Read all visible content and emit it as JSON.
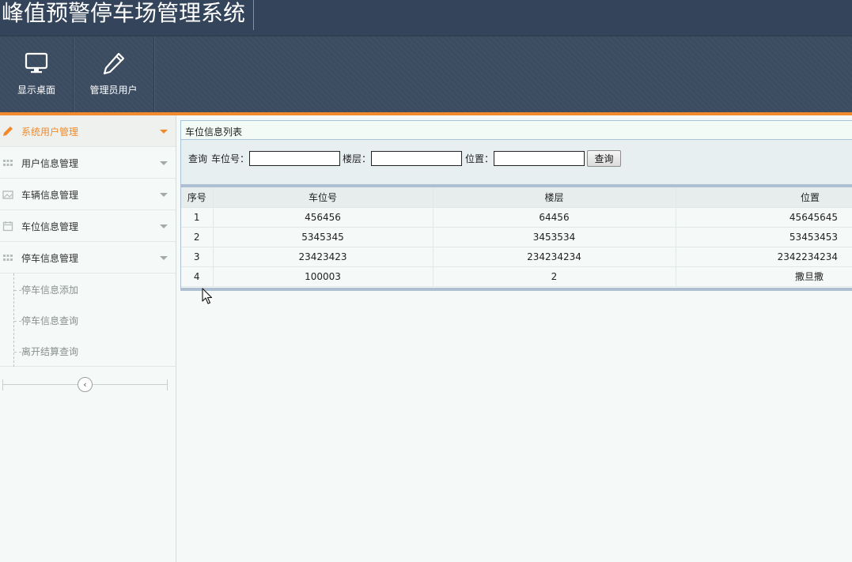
{
  "app": {
    "title": "峰值预警停车场管理系统"
  },
  "toolbar": {
    "items": [
      {
        "label": "显示桌面",
        "icon": "monitor-icon"
      },
      {
        "label": "管理员用户",
        "icon": "pencil-icon"
      }
    ]
  },
  "sidebar": {
    "menu": [
      {
        "label": "系统用户管理",
        "icon": "pencil-icon",
        "active": true
      },
      {
        "label": "用户信息管理",
        "icon": "grid-icon"
      },
      {
        "label": "车辆信息管理",
        "icon": "image-icon"
      },
      {
        "label": "车位信息管理",
        "icon": "calendar-icon"
      },
      {
        "label": "停车信息管理",
        "icon": "grid-icon"
      }
    ],
    "submenu": [
      "停车信息添加",
      "停车信息查询",
      "离开结算查询"
    ],
    "collapse_glyph": "‹"
  },
  "panel": {
    "title": "车位信息列表",
    "search": {
      "prefix": "查询",
      "fields": [
        {
          "label": "车位号：",
          "value": ""
        },
        {
          "label": "楼层：",
          "value": ""
        },
        {
          "label": "位置：",
          "value": ""
        }
      ],
      "button_label": "查询"
    },
    "table": {
      "headers": [
        "序号",
        "车位号",
        "楼层",
        "位置"
      ],
      "rows": [
        [
          "1",
          "456456",
          "64456",
          "45645645"
        ],
        [
          "2",
          "5345345",
          "3453534",
          "53453453"
        ],
        [
          "3",
          "23423423",
          "234234234",
          "2342234234"
        ],
        [
          "4",
          "100003",
          "2",
          "撒旦撒"
        ]
      ]
    }
  },
  "colors": {
    "accent": "#f08a2c",
    "header_bg": "#3b4b60",
    "table_border": "#aebfd1"
  }
}
